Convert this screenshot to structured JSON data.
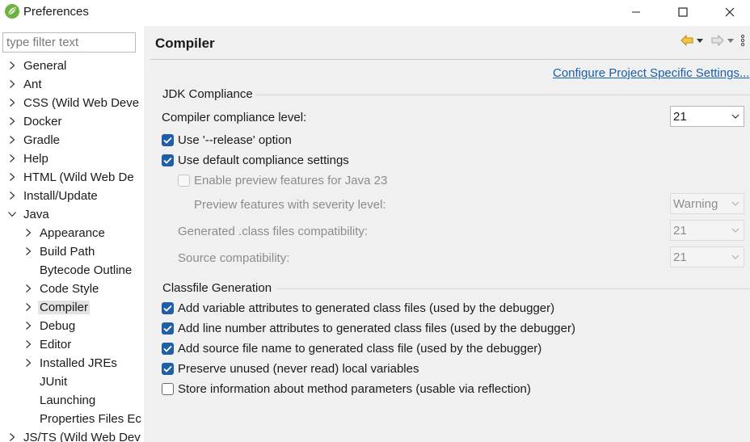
{
  "window": {
    "title": "Preferences",
    "controls": {
      "minimize": "minimize",
      "maximize": "maximize",
      "close": "close"
    },
    "app_icon": "spring-leaf-icon",
    "accent_color": "#6db33f"
  },
  "sidebar": {
    "filter_placeholder": "type filter text",
    "items": [
      {
        "label": "General",
        "expandable": true,
        "indent": 0
      },
      {
        "label": "Ant",
        "expandable": true,
        "indent": 0
      },
      {
        "label": "CSS (Wild Web Deve",
        "expandable": true,
        "indent": 0
      },
      {
        "label": "Docker",
        "expandable": true,
        "indent": 0
      },
      {
        "label": "Gradle",
        "expandable": true,
        "indent": 0
      },
      {
        "label": "Help",
        "expandable": true,
        "indent": 0
      },
      {
        "label": "HTML (Wild Web De",
        "expandable": true,
        "indent": 0
      },
      {
        "label": "Install/Update",
        "expandable": true,
        "indent": 0
      },
      {
        "label": "Java",
        "expandable": true,
        "expanded": true,
        "indent": 0
      },
      {
        "label": "Appearance",
        "expandable": true,
        "indent": 1
      },
      {
        "label": "Build Path",
        "expandable": true,
        "indent": 1
      },
      {
        "label": "Bytecode Outline",
        "expandable": false,
        "indent": 1
      },
      {
        "label": "Code Style",
        "expandable": true,
        "indent": 1
      },
      {
        "label": "Compiler",
        "expandable": true,
        "indent": 1,
        "selected": true
      },
      {
        "label": "Debug",
        "expandable": true,
        "indent": 1
      },
      {
        "label": "Editor",
        "expandable": true,
        "indent": 1
      },
      {
        "label": "Installed JREs",
        "expandable": true,
        "indent": 1
      },
      {
        "label": "JUnit",
        "expandable": false,
        "indent": 1
      },
      {
        "label": "Launching",
        "expandable": false,
        "indent": 1
      },
      {
        "label": "Properties Files Ec",
        "expandable": false,
        "indent": 1
      },
      {
        "label": "JS/TS (Wild Web Dev",
        "expandable": true,
        "indent": 0
      }
    ]
  },
  "page": {
    "title": "Compiler",
    "configure_link": "Configure Project Specific Settings...",
    "nav": {
      "back": "back-arrow-icon",
      "forward": "forward-arrow-icon",
      "menu": "more-menu-icon"
    }
  },
  "jdk_compliance": {
    "group_title": "JDK Compliance",
    "compliance_level_label": "Compiler compliance level:",
    "compliance_level_value": "21",
    "use_release_label": "Use '--release' option",
    "use_release_checked": true,
    "use_default_label": "Use default compliance settings",
    "use_default_checked": true,
    "enable_preview_label": "Enable preview features for Java 23",
    "enable_preview_checked": false,
    "preview_severity_label": "Preview features with severity level:",
    "preview_severity_value": "Warning",
    "generated_class_label": "Generated .class files compatibility:",
    "generated_class_value": "21",
    "source_compat_label": "Source compatibility:",
    "source_compat_value": "21"
  },
  "classfile_generation": {
    "group_title": "Classfile Generation",
    "options": [
      {
        "label": "Add variable attributes to generated class files (used by the debugger)",
        "checked": true
      },
      {
        "label": "Add line number attributes to generated class files (used by the debugger)",
        "checked": true
      },
      {
        "label": "Add source file name to generated class file (used by the debugger)",
        "checked": true
      },
      {
        "label": "Preserve unused (never read) local variables",
        "checked": true
      },
      {
        "label": "Store information about method parameters (usable via reflection)",
        "checked": false
      }
    ]
  },
  "colors": {
    "checkbox_checked": "#1f5fa8",
    "link": "#1b5faa",
    "panel_bg": "#f0f0f0",
    "selection_bg": "#e3e3e3"
  }
}
